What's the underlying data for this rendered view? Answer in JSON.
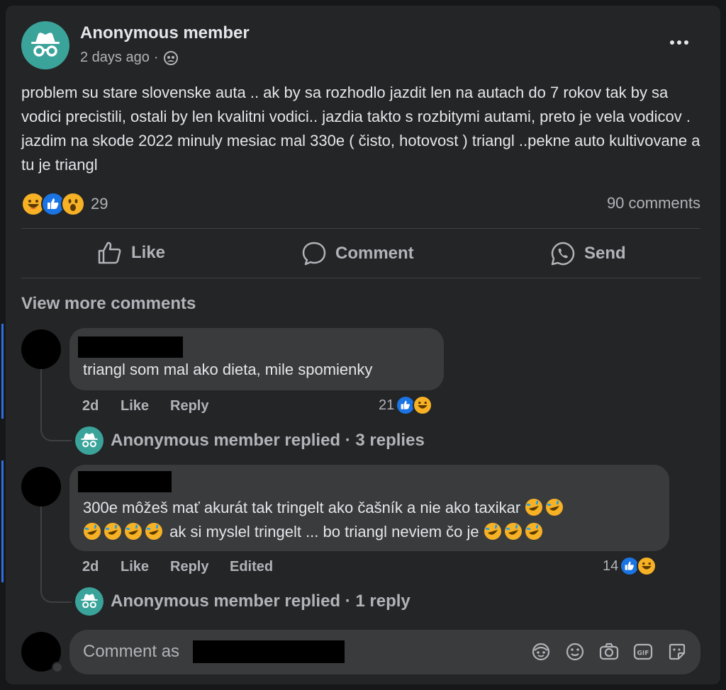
{
  "post": {
    "author": "Anonymous member",
    "time": "2 days ago",
    "dot": "·",
    "text": "problem su stare slovenske auta .. ak by sa rozhodlo jazdit len na autach do 7 rokov tak by sa vodici precistili, ostali by len kvalitni vodici.. jazdia takto s rozbitymi autami, preto je vela vodicov . jazdim na skode 2022 minuly mesiac mal 330e ( čisto, hotovost ) triangl ..pekne auto kultivovane a tu je triangl",
    "reaction_count": "29",
    "comments_count": "90 comments",
    "reactions": [
      "laugh-emoji",
      "like-emoji",
      "wow-emoji"
    ]
  },
  "actions": {
    "like": "Like",
    "comment": "Comment",
    "send": "Send"
  },
  "view_more": "View more comments",
  "comments": [
    {
      "text": "triangl som mal ako dieta, mile spomienky",
      "time": "2d",
      "like": "Like",
      "reply": "Reply",
      "reaction_count": "21",
      "replied_text": "Anonymous member replied · 3 replies"
    },
    {
      "text_line1": "300e môžeš mať akurát tak tringelt ako čašník a nie ako taxikar",
      "text_line2": "ak si myslel tringelt ... bo triangl neviem čo je",
      "time": "2d",
      "like": "Like",
      "reply": "Reply",
      "edited": "Edited",
      "reaction_count": "14",
      "replied_text": "Anonymous member replied · 1 reply"
    }
  ],
  "composer": {
    "placeholder": "Comment as"
  },
  "colors": {
    "background": "#242526",
    "bubble": "#3a3b3c",
    "accent_blue": "#2d6fe0",
    "anon_avatar": "#3aa39a"
  }
}
